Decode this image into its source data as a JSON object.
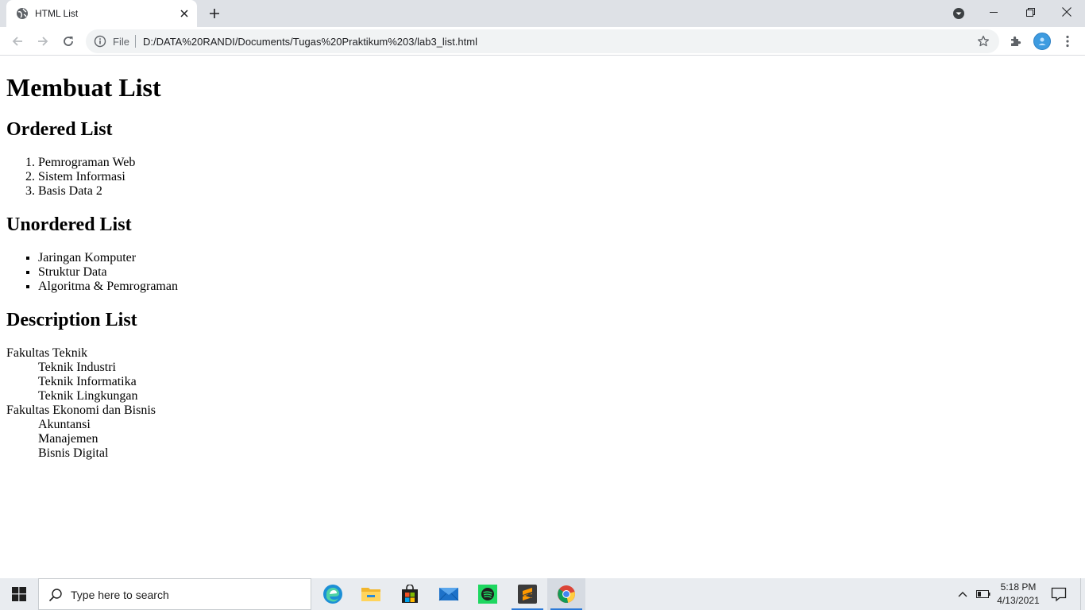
{
  "browser": {
    "tab": {
      "title": "HTML List",
      "favicon": "globe-icon"
    },
    "address_bar": {
      "scheme_label": "File",
      "url": "D:/DATA%20RANDI/Documents/Tugas%20Praktikum%203/lab3_list.html"
    },
    "icons": {
      "back": "arrow-left-icon",
      "forward": "arrow-right-icon",
      "reload": "reload-icon",
      "info": "info-icon",
      "bookmark": "star-icon",
      "extensions": "puzzle-icon",
      "menu": "more-vert-icon"
    }
  },
  "content": {
    "h1": "Membuat List",
    "ordered": {
      "heading": "Ordered List",
      "items": [
        "Pemrograman Web",
        "Sistem Informasi",
        "Basis Data 2"
      ]
    },
    "unordered": {
      "heading": "Unordered List",
      "items": [
        "Jaringan Komputer",
        "Struktur Data",
        "Algoritma & Pemrograman"
      ]
    },
    "description": {
      "heading": "Description List",
      "groups": [
        {
          "term": "Fakultas Teknik",
          "defs": [
            "Teknik Industri",
            "Teknik Informatika",
            "Teknik Lingkungan"
          ]
        },
        {
          "term": "Fakultas Ekonomi dan Bisnis",
          "defs": [
            "Akuntansi",
            "Manajemen",
            "Bisnis Digital"
          ]
        }
      ]
    }
  },
  "taskbar": {
    "search_placeholder": "Type here to search",
    "apps": [
      "edge-icon",
      "file-explorer-icon",
      "store-icon",
      "mail-icon",
      "spotify-icon",
      "sublime-text-icon",
      "chrome-icon"
    ],
    "clock": {
      "time": "5:18 PM",
      "date": "4/13/2021"
    }
  },
  "colors": {
    "tabstrip": "#dee1e6",
    "omnibox": "#f1f3f4",
    "taskbar": "#e9ecf0",
    "accent": "#2b79d8"
  }
}
